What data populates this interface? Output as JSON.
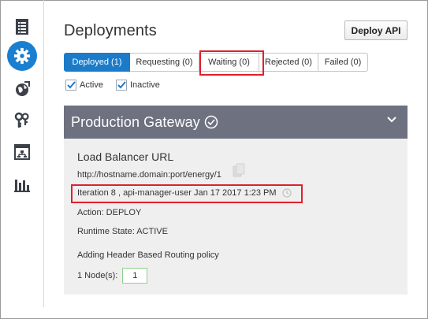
{
  "sidebar": {
    "items": [
      {
        "icon": "document-list-icon",
        "active": false
      },
      {
        "icon": "gear-icon",
        "active": true
      },
      {
        "icon": "globe-deploy-icon",
        "active": false
      },
      {
        "icon": "keys-icon",
        "active": false
      },
      {
        "icon": "topology-icon",
        "active": false
      },
      {
        "icon": "bar-chart-icon",
        "active": false
      }
    ]
  },
  "header": {
    "title": "Deployments",
    "deploy_button": "Deploy API"
  },
  "tabs": [
    {
      "label": "Deployed (1)",
      "selected": true
    },
    {
      "label": "Requesting (0)",
      "selected": false
    },
    {
      "label": "Waiting (0)",
      "selected": false
    },
    {
      "label": "Rejected (0)",
      "selected": false
    },
    {
      "label": "Failed (0)",
      "selected": false
    }
  ],
  "filters": {
    "active_label": "Active",
    "active_checked": true,
    "inactive_label": "Inactive",
    "inactive_checked": true
  },
  "gateway": {
    "title": "Production Gateway",
    "load_balancer_label": "Load Balancer URL",
    "load_balancer_url": "http://hostname.domain:port/energy/1",
    "iteration": "Iteration 8 , api-manager-user  Jan 17 2017 1:23 PM",
    "action": "Action: DEPLOY",
    "runtime_state": "Runtime State: ACTIVE",
    "routing_note": "Adding Header Based Routing policy",
    "nodes_label": "1 Node(s):",
    "nodes_count": "1"
  },
  "colors": {
    "accent": "#1b7bc9",
    "panel_header": "#6d7180",
    "panel_body": "#efefef",
    "highlight": "#e0202c"
  }
}
